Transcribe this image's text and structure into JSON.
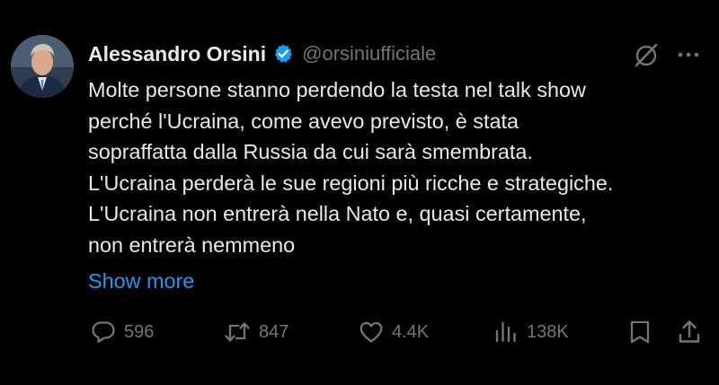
{
  "author": {
    "display_name": "Alessandro Orsini",
    "handle": "@orsiniufficiale",
    "verified": true,
    "avatar": "avatar-photo"
  },
  "tweet": {
    "lines": [
      "Molte persone stanno perdendo la testa nel talk show",
      "perché l'Ucraina, come avevo previsto, è stata",
      "sopraffatta dalla Russia da cui sarà smembrata.",
      "L'Ucraina perderà le sue regioni più ricche e strategiche.",
      "L'Ucraina non entrerà nella Nato e, quasi certamente,",
      "non entrerà nemmeno"
    ],
    "show_more": "Show more"
  },
  "actions": {
    "replies": "596",
    "reposts": "847",
    "likes": "4.4K",
    "views": "138K"
  },
  "icons": {
    "header_right": [
      "grok-icon",
      "more-icon"
    ],
    "actions": [
      "reply-icon",
      "repost-icon",
      "like-icon",
      "views-icon",
      "bookmark-icon",
      "share-icon"
    ]
  },
  "colors": {
    "background": "#000000",
    "text": "#e7e9ea",
    "secondary": "#71767b",
    "accent": "#1d9bf0"
  }
}
